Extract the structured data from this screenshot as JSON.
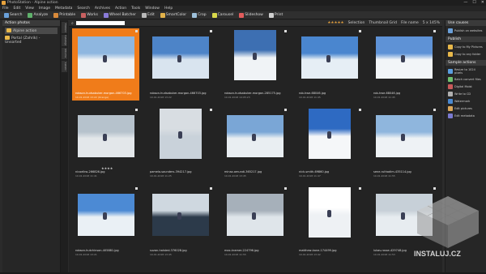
{
  "window": {
    "title": "PhotoStation - Alpine action",
    "buttons": [
      "—",
      "☐",
      "✕"
    ]
  },
  "menu": [
    "File",
    "Edit",
    "View",
    "Image",
    "Metadata",
    "Search",
    "Archives",
    "Action",
    "Tools",
    "Window",
    "Help"
  ],
  "toolbar": [
    {
      "label": "Search",
      "icon": "search-icon",
      "color": "#6aa0d8"
    },
    {
      "label": "Analyze",
      "icon": "analyze-icon",
      "color": "#5fb16b"
    },
    {
      "label": "Printable",
      "icon": "print-icon",
      "color": "#d98a3a"
    },
    {
      "label": "Works",
      "icon": "works-icon",
      "color": "#c76060"
    },
    {
      "label": "Wheel Batcher",
      "icon": "wheel-icon",
      "color": "#8a7bd8"
    },
    {
      "label": "Edit",
      "icon": "edit-icon",
      "color": "#b8b8b8"
    },
    {
      "label": "SmartColor",
      "icon": "color-icon",
      "color": "#e2b24a"
    },
    {
      "label": "Crop",
      "icon": "crop-icon",
      "color": "#9ec0da"
    },
    {
      "label": "Carousel",
      "icon": "carousel-icon",
      "color": "#d8d84a"
    },
    {
      "label": "Slideshow",
      "icon": "slideshow-icon",
      "color": "#e25c5c"
    },
    {
      "label": "Print",
      "icon": "printer-icon",
      "color": "#cfcfcf"
    }
  ],
  "left_panel": {
    "header": "Action photos",
    "items": [
      {
        "label": "Alpine action",
        "icon": "folder-icon",
        "selected": true
      },
      {
        "label": "Portal (Zahrik) - Unsorted",
        "icon": "folder-icon",
        "selected": false
      }
    ]
  },
  "vertical_tabs": [
    "Folders",
    "Catalogs",
    "Albums",
    "Labels"
  ],
  "viewbar": {
    "search_placeholder": "",
    "selection": "Selection",
    "thumbnail": "Thumbnail Grid",
    "sort": "File name",
    "size": "5 x 145%",
    "stars": "★★★★★"
  },
  "photos": [
    {
      "name": "robson-hudsabuker-morgan-466703.jpg",
      "date": "10.01.2018 13:22 (Orange)",
      "rating": "",
      "selected": true,
      "sky": "#8fb7e0",
      "fill": "#eef2f5"
    },
    {
      "name": "robson-hudsabuker-morgan-466703.jpg",
      "date": "10.01.2018 13:22",
      "rating": "",
      "selected": false,
      "sky": "#4d84c8",
      "fill": "#d9e4ef"
    },
    {
      "name": "robson-hudsabuker-morgan-285175.jpg",
      "date": "10.01.2018 14:05:23",
      "rating": "",
      "selected": false,
      "sky": "#3d6fb2",
      "fill": "#f0f3f6"
    },
    {
      "name": "rob-hwe-68046.jpg",
      "date": "10.01.2018 11:45",
      "rating": "",
      "selected": false,
      "sky": "#4a86cf",
      "fill": "#e6eef5"
    },
    {
      "name": "rob-hwe-68046.jpg",
      "date": "10.01.2018 11:45",
      "rating": "",
      "selected": false,
      "sky": "#5e92d6",
      "fill": "#f2f5f8"
    },
    {
      "name": "nicoelkw-266826.jpg",
      "date": "10.01.2018 11:41",
      "rating": "★★★★",
      "selected": false,
      "sky": "#b6c2cc",
      "fill": "#e3e7ea"
    },
    {
      "name": "pamela-saunders-394217.jpg",
      "date": "10.01.2018 11:25",
      "rating": "",
      "selected": false,
      "sky": "#d8dde2",
      "fill": "#c9d2da"
    },
    {
      "name": "minaz-amundi-365217.jpg",
      "date": "10.01.2018 13:45",
      "rating": "",
      "selected": false,
      "sky": "#7aa6d6",
      "fill": "#e9eef2"
    },
    {
      "name": "nick-smith-69860.jpg",
      "date": "10.01.2018 11:47",
      "rating": "",
      "selected": false,
      "sky": "#2e6ac2",
      "fill": "#f5f7f9"
    },
    {
      "name": "sene-ruthadim-435114.jpg",
      "date": "10.01.2018 11:55",
      "rating": "",
      "selected": false,
      "sky": "#8fb6dd",
      "fill": "#eef2f5"
    },
    {
      "name": "robson-hutchinson-405881.jpg",
      "date": "10.01.2018 13:21",
      "rating": "",
      "selected": false,
      "sky": "#4c8ad4",
      "fill": "#eaf0f5"
    },
    {
      "name": "suzan-halsted-376028.jpg",
      "date": "10.01.2018 13:45",
      "rating": "",
      "selected": false,
      "sky": "#cfd8e0",
      "fill": "#2c3a4a"
    },
    {
      "name": "max-kramer-224796.jpg",
      "date": "10.01.2018 11:55",
      "rating": "",
      "selected": false,
      "sky": "#a6b0ba",
      "fill": "#dfe5ea"
    },
    {
      "name": "matthew-kane-174499.jpg",
      "date": "10.01.2018 13:42",
      "rating": "",
      "selected": false,
      "sky": "#ffffff",
      "fill": "#eef1f4"
    },
    {
      "name": "lukas-rosse-429748.jpg",
      "date": "10.01.2018 11:53",
      "rating": "",
      "selected": false,
      "sky": "#c7d0d8",
      "fill": "#e7ecf0"
    }
  ],
  "right_panel": {
    "sections": [
      {
        "header": "Use causes",
        "items": [
          {
            "label": "Publish on websites",
            "icon": "globe-icon",
            "color": "#6a9fd8"
          }
        ]
      },
      {
        "header": "Publish",
        "items": [
          {
            "label": "Copy to My Pictures",
            "icon": "folder-copy-icon",
            "color": "#e8b84a"
          },
          {
            "label": "Copy to any folder",
            "icon": "folder-copy-icon",
            "color": "#e8b84a"
          }
        ]
      },
      {
        "header": "Sample actions",
        "items": [
          {
            "label": "Resize to 1024 pixels",
            "icon": "resize-icon",
            "color": "#5a9ee0"
          },
          {
            "label": "Batch convert files",
            "icon": "convert-icon",
            "color": "#6ec06e"
          },
          {
            "label": "Digital Moist",
            "icon": "moist-icon",
            "color": "#c95a5a"
          },
          {
            "label": "Write to CD",
            "icon": "cd-icon",
            "color": "#b0b0b0"
          },
          {
            "label": "Watermark",
            "icon": "watermark-icon",
            "color": "#4a88d0"
          },
          {
            "label": "Edit pictures",
            "icon": "edit-icon",
            "color": "#dca85a"
          },
          {
            "label": "Edit metadata",
            "icon": "metadata-icon",
            "color": "#7a7ad0"
          }
        ]
      }
    ]
  },
  "watermark": {
    "text": "INSTALUJ.CZ"
  }
}
